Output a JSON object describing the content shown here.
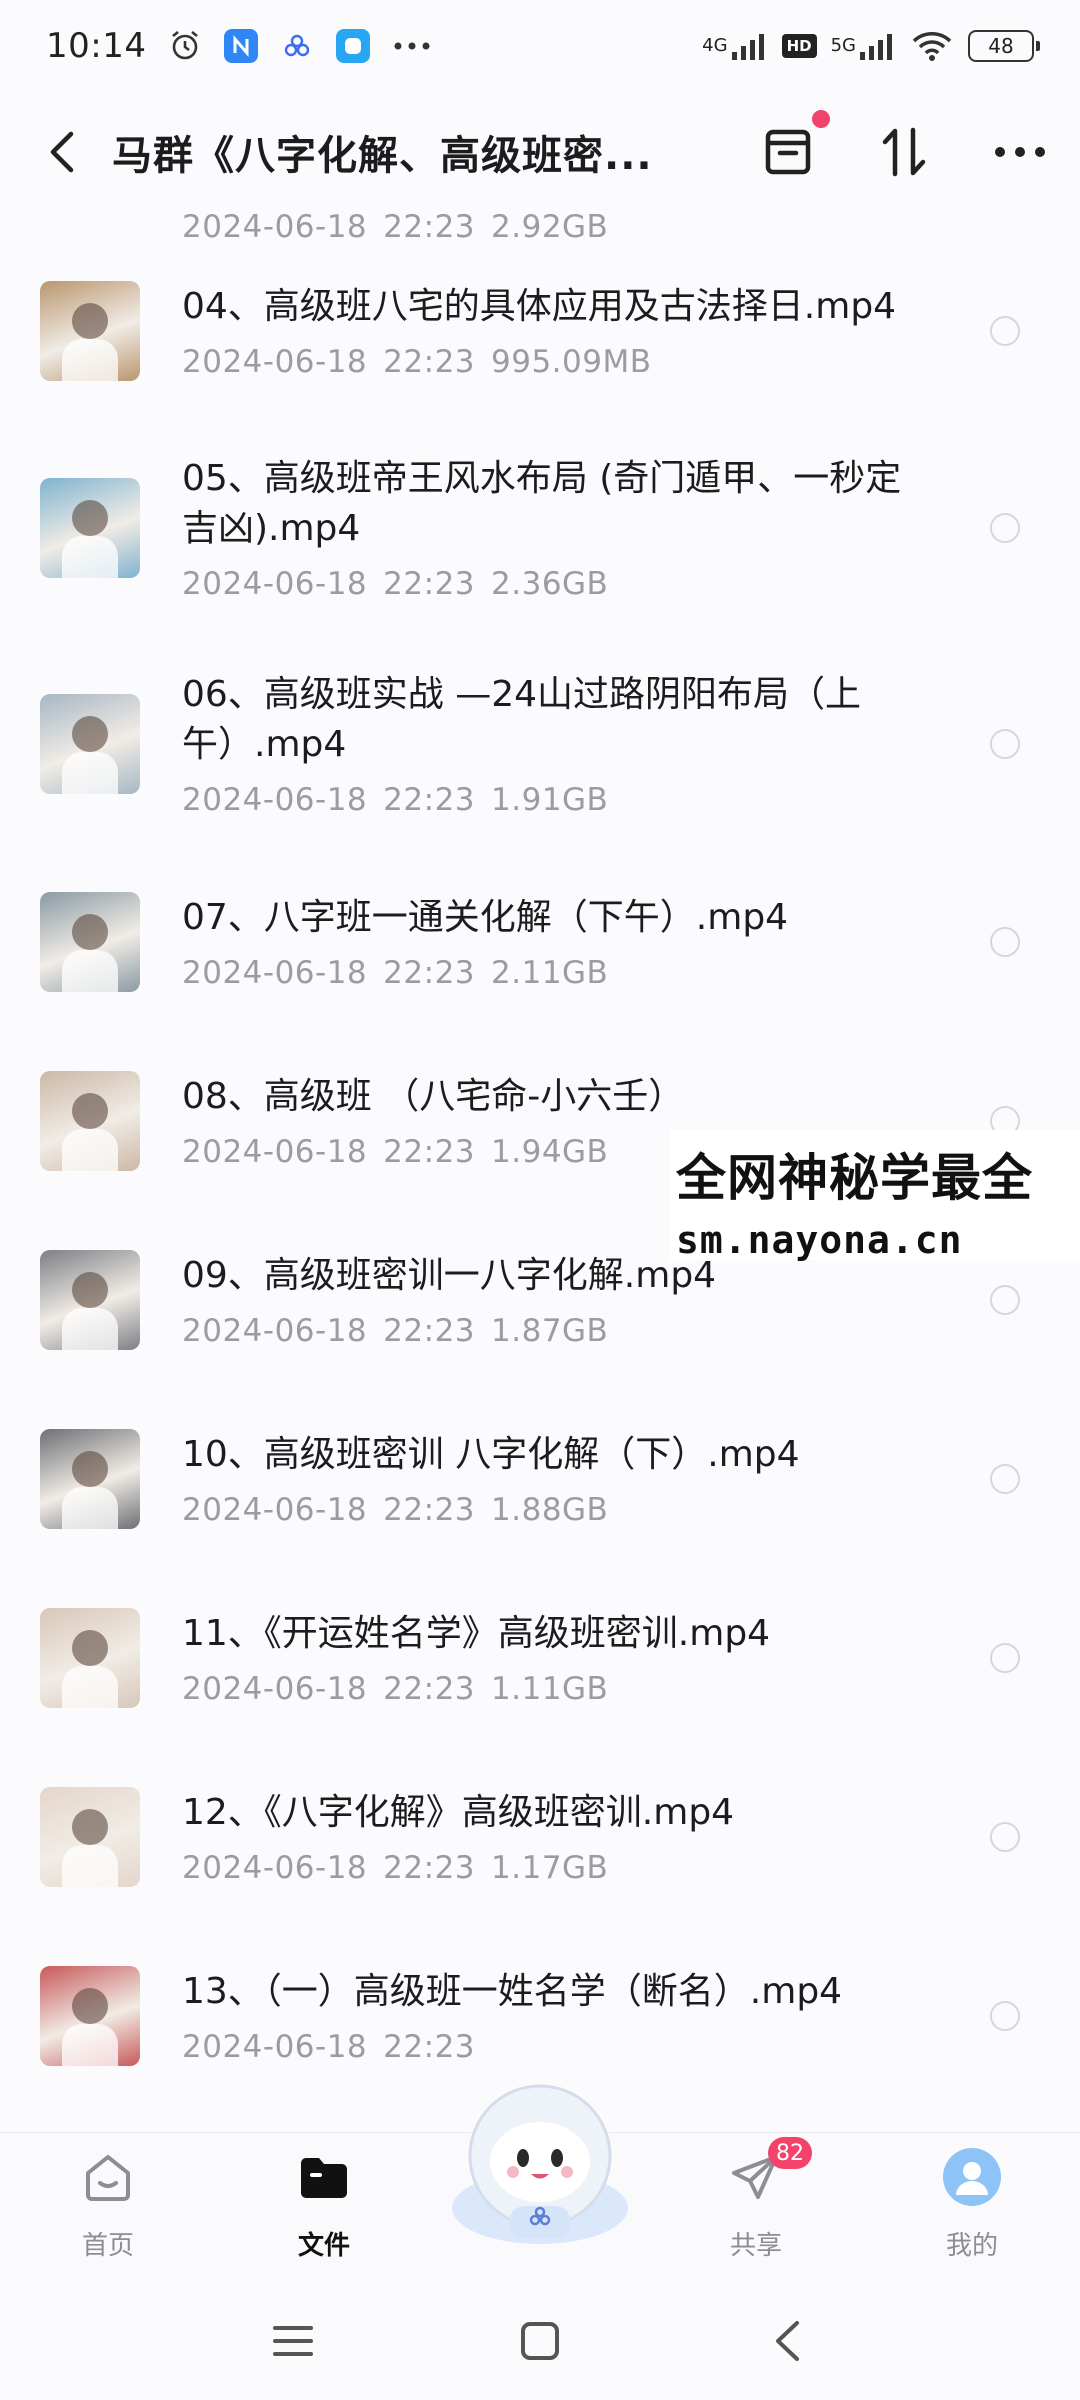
{
  "status_bar": {
    "time": "10:14",
    "net1": "4G",
    "hd": "HD",
    "net2": "5G",
    "battery": "48"
  },
  "header": {
    "title": "马群《八字化解、高级班密..."
  },
  "files": [
    {
      "name": "",
      "date": "2024-06-18",
      "time": "22:23",
      "size": "2.92GB",
      "thumb": "#c7a38b"
    },
    {
      "name": "04、高级班八宅的具体应用及古法择日.mp4",
      "date": "2024-06-18",
      "time": "22:23",
      "size": "995.09MB",
      "thumb": "#b9966f"
    },
    {
      "name": "05、高级班帝王风水布局 (奇门遁甲、一秒定吉凶).mp4",
      "date": "2024-06-18",
      "time": "22:23",
      "size": "2.36GB",
      "thumb": "#7fb3cf"
    },
    {
      "name": "06、高级班实战 —24山过路阴阳布局（上午）.mp4",
      "date": "2024-06-18",
      "time": "22:23",
      "size": "1.91GB",
      "thumb": "#a7b7c4"
    },
    {
      "name": "07、八字班一通关化解（下午）.mp4",
      "date": "2024-06-18",
      "time": "22:23",
      "size": "2.11GB",
      "thumb": "#8a9aa3"
    },
    {
      "name": "08、高级班 （八宅命-小六壬）",
      "date": "2024-06-18",
      "time": "22:23",
      "size": "1.94GB",
      "thumb": "#cbb8a6"
    },
    {
      "name": "09、高级班密训一八字化解.mp4",
      "date": "2024-06-18",
      "time": "22:23",
      "size": "1.87GB",
      "thumb": "#7d7f86"
    },
    {
      "name": "10、高级班密训 八字化解（下）.mp4",
      "date": "2024-06-18",
      "time": "22:23",
      "size": "1.88GB",
      "thumb": "#6d7075"
    },
    {
      "name": "11、《开运姓名学》高级班密训.mp4",
      "date": "2024-06-18",
      "time": "22:23",
      "size": "1.11GB",
      "thumb": "#d8c7b8"
    },
    {
      "name": "12、《八字化解》高级班密训.mp4",
      "date": "2024-06-18",
      "time": "22:23",
      "size": "1.17GB",
      "thumb": "#e4d6cb"
    },
    {
      "name": "13、（一）高级班一姓名学（断名）.mp4",
      "date": "2024-06-18",
      "time": "22:23",
      "size": "",
      "thumb": "#c75a5a"
    }
  ],
  "watermark": {
    "line1": "全网神秘学最全",
    "line2": "sm.nayona.cn"
  },
  "tabs": [
    {
      "label": "首页",
      "icon": "home-icon"
    },
    {
      "label": "文件",
      "icon": "folder-icon"
    },
    {
      "label": "",
      "icon": "mascot-icon"
    },
    {
      "label": "共享",
      "icon": "send-icon",
      "badge": "82"
    },
    {
      "label": "我的",
      "icon": "avatar-icon"
    }
  ],
  "accent_color": "#f2436a"
}
